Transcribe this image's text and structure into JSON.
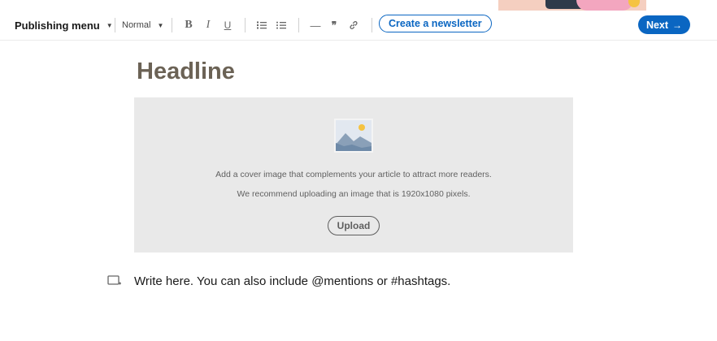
{
  "toolbar": {
    "publishing_menu_label": "Publishing menu",
    "text_style": "Normal",
    "format_buttons": [
      {
        "name": "bold",
        "glyph": "B"
      },
      {
        "name": "italic",
        "glyph": "I"
      },
      {
        "name": "underline",
        "glyph": "U"
      }
    ],
    "create_newsletter_label": "Create a newsletter",
    "next_label": "Next",
    "next_arrow": "→",
    "quote_glyph": "❞",
    "divider_glyph": "—"
  },
  "editor": {
    "headline_placeholder": "Headline",
    "cover": {
      "line1": "Add a cover image that complements your article to attract more readers.",
      "line2": "We recommend uploading an image that is 1920x1080 pixels.",
      "upload_label": "Upload"
    },
    "body_placeholder": "Write here. You can also include @mentions or #hashtags."
  },
  "colors": {
    "accent": "#0a66c2",
    "headline": "#6b6255",
    "cover_bg": "#e9e9e9"
  },
  "icons": [
    "caret-down-icon",
    "numbered-list-icon",
    "bulleted-list-icon",
    "horizontal-rule-icon",
    "quote-icon",
    "link-icon",
    "image-placeholder-icon",
    "insert-block-icon",
    "arrow-right-icon"
  ]
}
